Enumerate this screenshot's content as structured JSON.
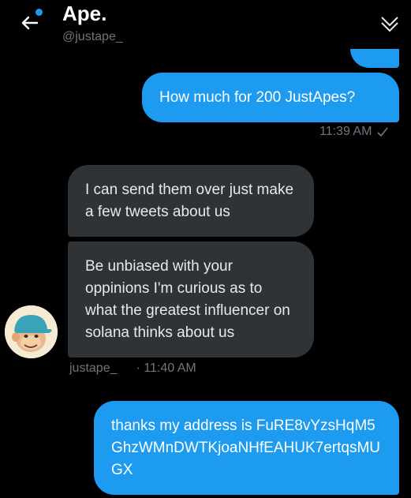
{
  "header": {
    "title": "Ape.",
    "handle": "@justape_"
  },
  "colors": {
    "accent": "#1d9bf0",
    "incoming_bubble": "#2f3336",
    "muted_text": "#6e767d",
    "background": "#000000"
  },
  "icons": {
    "back": "arrow-left-icon",
    "collapse": "chevron-double-down-icon",
    "read_receipt": "check-icon"
  },
  "messages": [
    {
      "direction": "outgoing",
      "text": "How much for 200 JustApes?"
    },
    {
      "direction": "incoming",
      "text": "I can send them over just make a few tweets about us"
    },
    {
      "direction": "incoming",
      "text": "Be unbiased with your oppinions I'm curious as to what the greatest influencer on solana thinks about us"
    },
    {
      "direction": "outgoing",
      "text": "thanks my address is FuRE8vYzsHqM5GhzWMnDWTKjoaNHfEAHUK7ertqsMUGX"
    }
  ],
  "meta": {
    "outgoing_time": "11:39 AM",
    "incoming_sender": "justape_",
    "incoming_time": "· 11:40 AM"
  }
}
